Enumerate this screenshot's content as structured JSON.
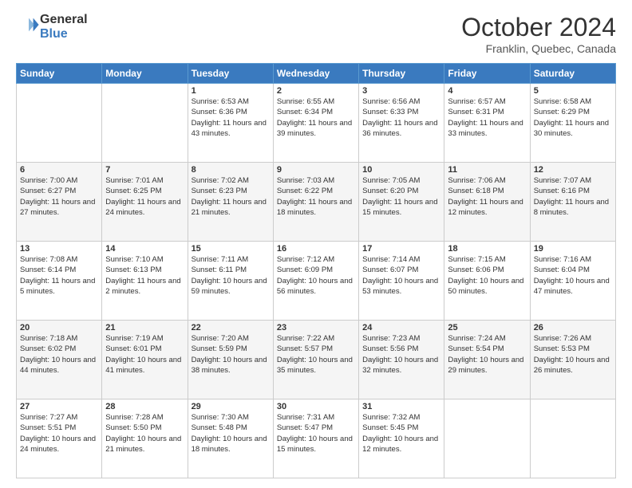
{
  "header": {
    "logo_line1": "General",
    "logo_line2": "Blue",
    "month": "October 2024",
    "location": "Franklin, Quebec, Canada"
  },
  "days_of_week": [
    "Sunday",
    "Monday",
    "Tuesday",
    "Wednesday",
    "Thursday",
    "Friday",
    "Saturday"
  ],
  "weeks": [
    [
      {
        "day": "",
        "info": ""
      },
      {
        "day": "",
        "info": ""
      },
      {
        "day": "1",
        "info": "Sunrise: 6:53 AM\nSunset: 6:36 PM\nDaylight: 11 hours and 43 minutes."
      },
      {
        "day": "2",
        "info": "Sunrise: 6:55 AM\nSunset: 6:34 PM\nDaylight: 11 hours and 39 minutes."
      },
      {
        "day": "3",
        "info": "Sunrise: 6:56 AM\nSunset: 6:33 PM\nDaylight: 11 hours and 36 minutes."
      },
      {
        "day": "4",
        "info": "Sunrise: 6:57 AM\nSunset: 6:31 PM\nDaylight: 11 hours and 33 minutes."
      },
      {
        "day": "5",
        "info": "Sunrise: 6:58 AM\nSunset: 6:29 PM\nDaylight: 11 hours and 30 minutes."
      }
    ],
    [
      {
        "day": "6",
        "info": "Sunrise: 7:00 AM\nSunset: 6:27 PM\nDaylight: 11 hours and 27 minutes."
      },
      {
        "day": "7",
        "info": "Sunrise: 7:01 AM\nSunset: 6:25 PM\nDaylight: 11 hours and 24 minutes."
      },
      {
        "day": "8",
        "info": "Sunrise: 7:02 AM\nSunset: 6:23 PM\nDaylight: 11 hours and 21 minutes."
      },
      {
        "day": "9",
        "info": "Sunrise: 7:03 AM\nSunset: 6:22 PM\nDaylight: 11 hours and 18 minutes."
      },
      {
        "day": "10",
        "info": "Sunrise: 7:05 AM\nSunset: 6:20 PM\nDaylight: 11 hours and 15 minutes."
      },
      {
        "day": "11",
        "info": "Sunrise: 7:06 AM\nSunset: 6:18 PM\nDaylight: 11 hours and 12 minutes."
      },
      {
        "day": "12",
        "info": "Sunrise: 7:07 AM\nSunset: 6:16 PM\nDaylight: 11 hours and 8 minutes."
      }
    ],
    [
      {
        "day": "13",
        "info": "Sunrise: 7:08 AM\nSunset: 6:14 PM\nDaylight: 11 hours and 5 minutes."
      },
      {
        "day": "14",
        "info": "Sunrise: 7:10 AM\nSunset: 6:13 PM\nDaylight: 11 hours and 2 minutes."
      },
      {
        "day": "15",
        "info": "Sunrise: 7:11 AM\nSunset: 6:11 PM\nDaylight: 10 hours and 59 minutes."
      },
      {
        "day": "16",
        "info": "Sunrise: 7:12 AM\nSunset: 6:09 PM\nDaylight: 10 hours and 56 minutes."
      },
      {
        "day": "17",
        "info": "Sunrise: 7:14 AM\nSunset: 6:07 PM\nDaylight: 10 hours and 53 minutes."
      },
      {
        "day": "18",
        "info": "Sunrise: 7:15 AM\nSunset: 6:06 PM\nDaylight: 10 hours and 50 minutes."
      },
      {
        "day": "19",
        "info": "Sunrise: 7:16 AM\nSunset: 6:04 PM\nDaylight: 10 hours and 47 minutes."
      }
    ],
    [
      {
        "day": "20",
        "info": "Sunrise: 7:18 AM\nSunset: 6:02 PM\nDaylight: 10 hours and 44 minutes."
      },
      {
        "day": "21",
        "info": "Sunrise: 7:19 AM\nSunset: 6:01 PM\nDaylight: 10 hours and 41 minutes."
      },
      {
        "day": "22",
        "info": "Sunrise: 7:20 AM\nSunset: 5:59 PM\nDaylight: 10 hours and 38 minutes."
      },
      {
        "day": "23",
        "info": "Sunrise: 7:22 AM\nSunset: 5:57 PM\nDaylight: 10 hours and 35 minutes."
      },
      {
        "day": "24",
        "info": "Sunrise: 7:23 AM\nSunset: 5:56 PM\nDaylight: 10 hours and 32 minutes."
      },
      {
        "day": "25",
        "info": "Sunrise: 7:24 AM\nSunset: 5:54 PM\nDaylight: 10 hours and 29 minutes."
      },
      {
        "day": "26",
        "info": "Sunrise: 7:26 AM\nSunset: 5:53 PM\nDaylight: 10 hours and 26 minutes."
      }
    ],
    [
      {
        "day": "27",
        "info": "Sunrise: 7:27 AM\nSunset: 5:51 PM\nDaylight: 10 hours and 24 minutes."
      },
      {
        "day": "28",
        "info": "Sunrise: 7:28 AM\nSunset: 5:50 PM\nDaylight: 10 hours and 21 minutes."
      },
      {
        "day": "29",
        "info": "Sunrise: 7:30 AM\nSunset: 5:48 PM\nDaylight: 10 hours and 18 minutes."
      },
      {
        "day": "30",
        "info": "Sunrise: 7:31 AM\nSunset: 5:47 PM\nDaylight: 10 hours and 15 minutes."
      },
      {
        "day": "31",
        "info": "Sunrise: 7:32 AM\nSunset: 5:45 PM\nDaylight: 10 hours and 12 minutes."
      },
      {
        "day": "",
        "info": ""
      },
      {
        "day": "",
        "info": ""
      }
    ]
  ]
}
